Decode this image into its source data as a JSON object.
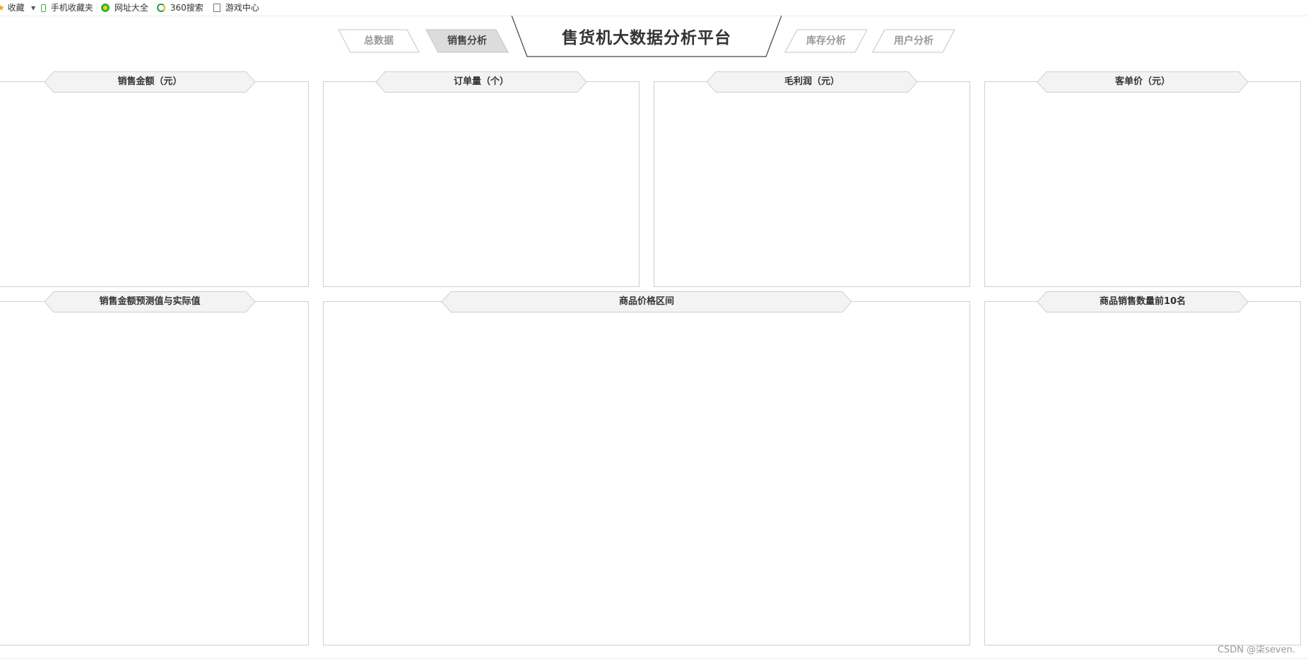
{
  "bookmarks": {
    "favorites": "收藏",
    "mobile_favorites": "手机收藏夹",
    "site_directory": "网址大全",
    "search_360": "360搜索",
    "game_center": "游戏中心"
  },
  "nav": {
    "title": "售货机大数据分析平台",
    "tabs": [
      "总数据",
      "销售分析",
      "库存分析",
      "用户分析"
    ],
    "active_tab": "销售分析"
  },
  "panels": {
    "sales_amount": "销售金额（元）",
    "order_count": "订单量（个）",
    "gross_profit": "毛利润（元）",
    "avg_order_value": "客单价（元）",
    "sales_forecast": "销售金额预测值与实际值",
    "price_range": "商品价格区间",
    "top10_products": "商品销售数量前10名"
  },
  "watermark": "CSDN @柒seven."
}
